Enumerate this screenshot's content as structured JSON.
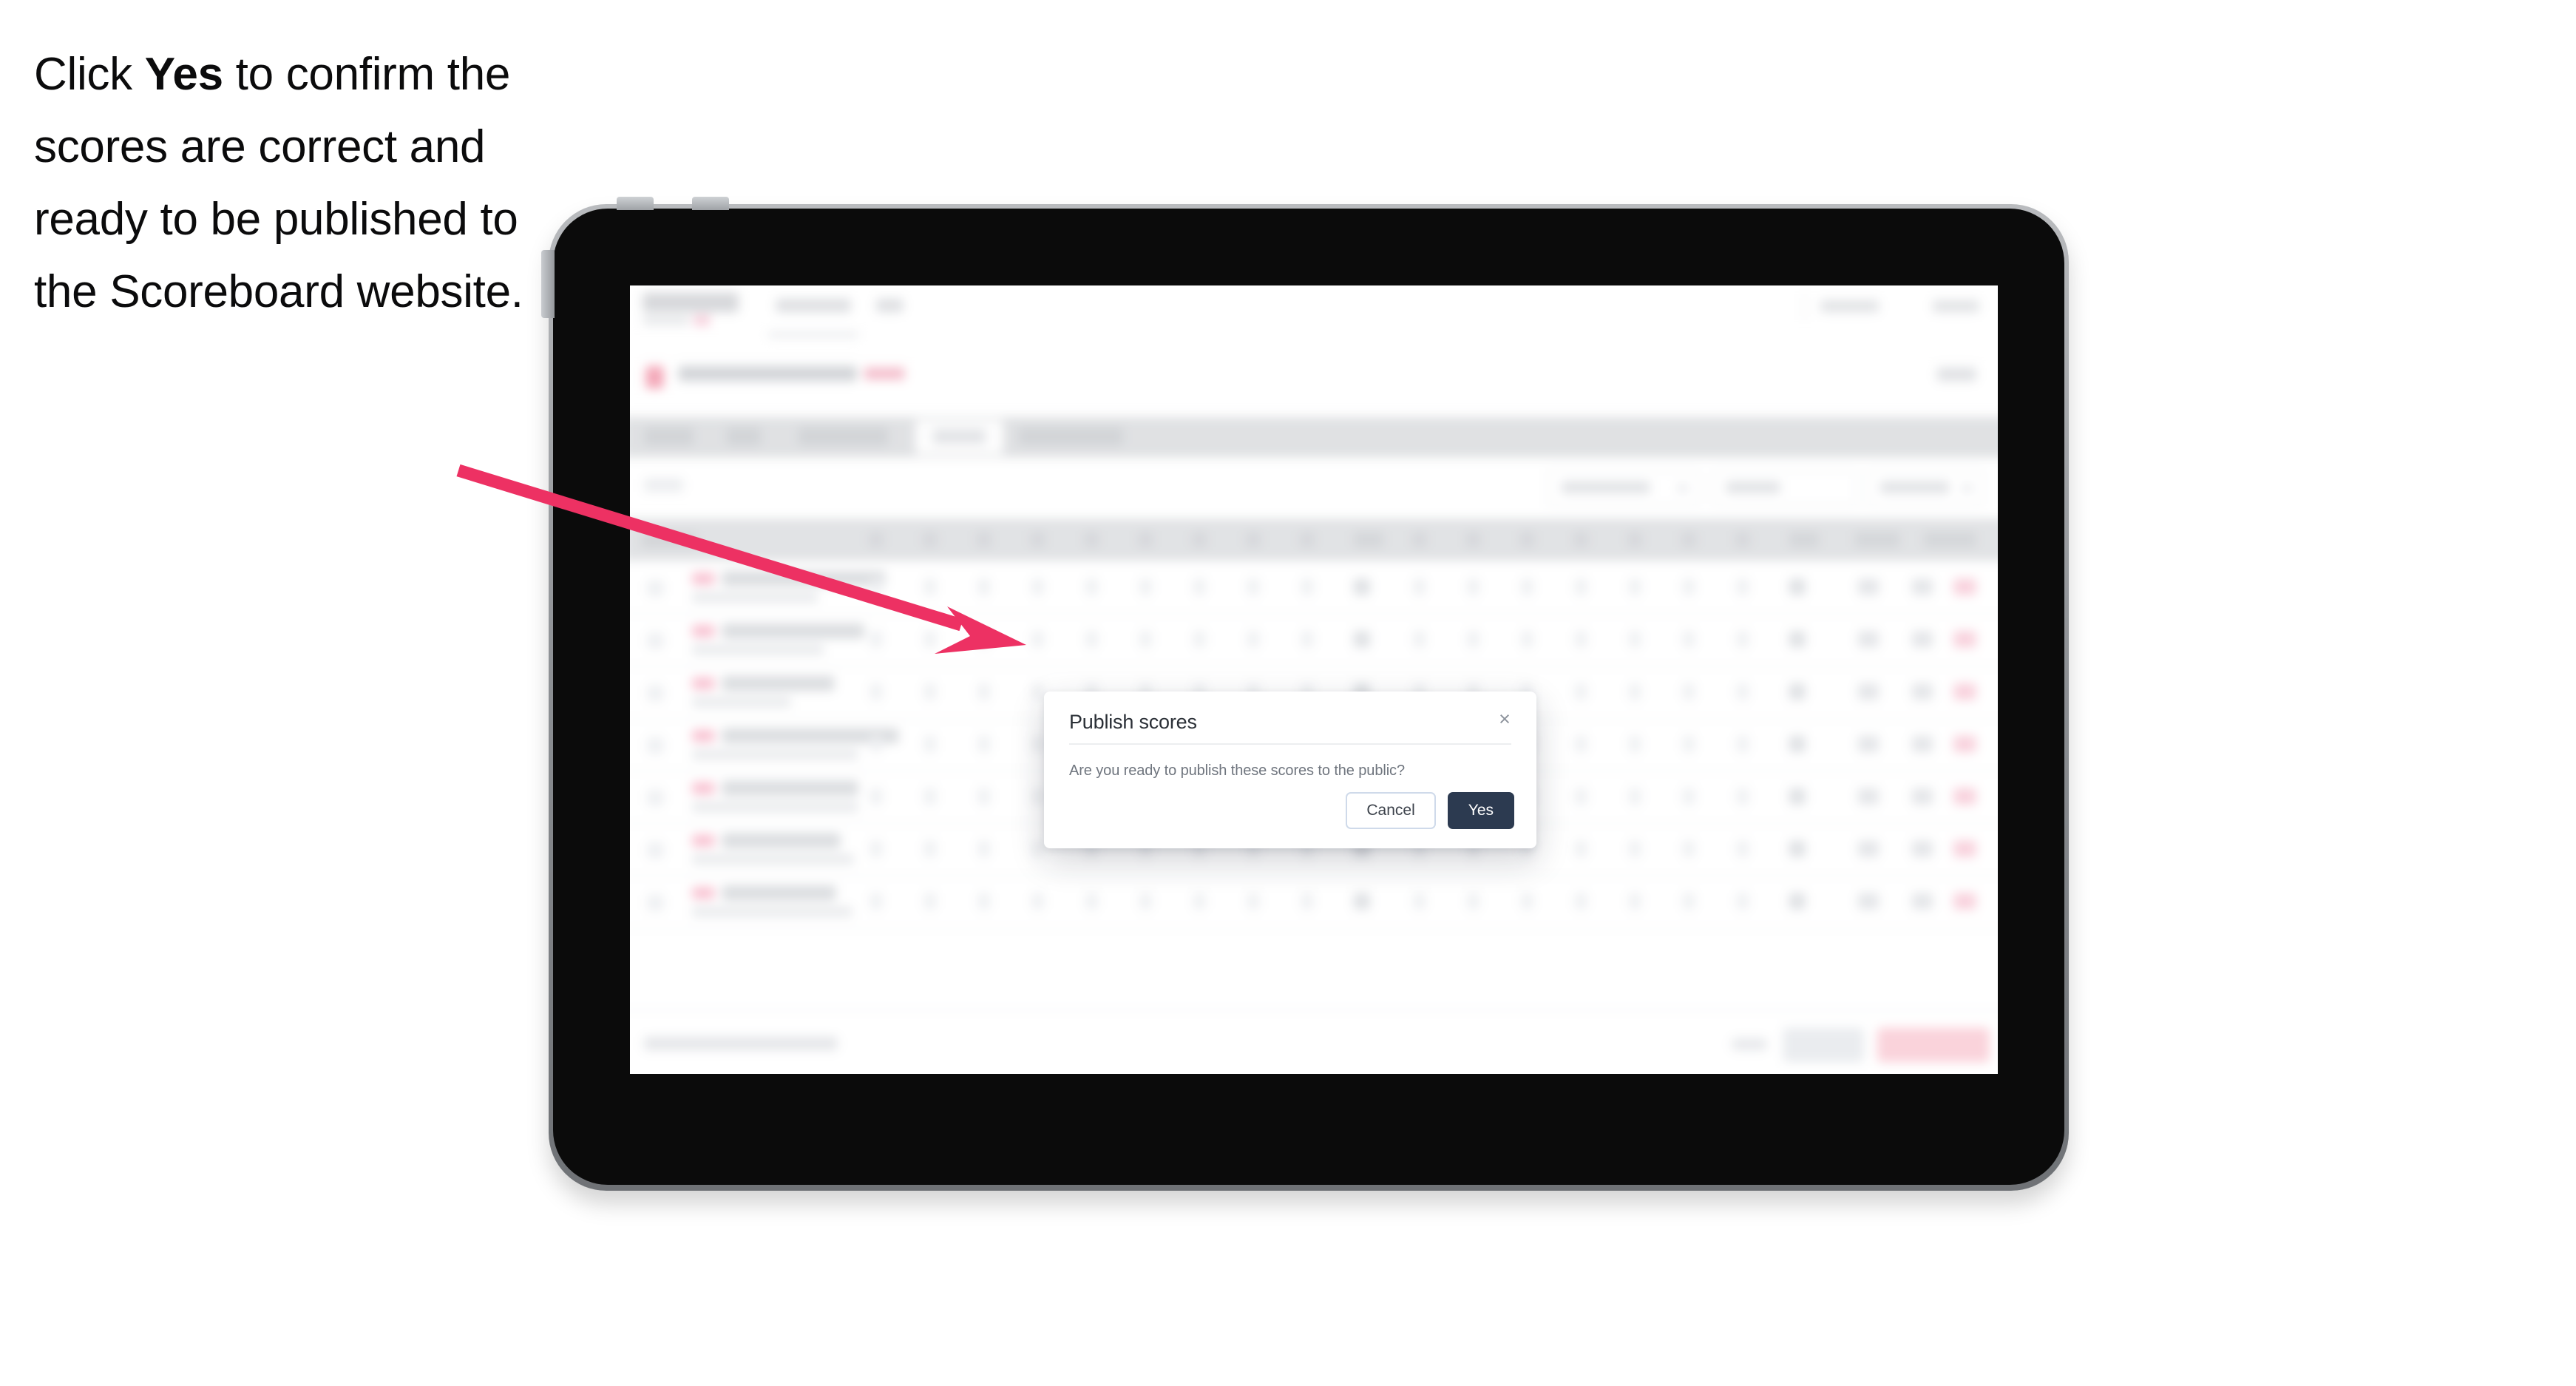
{
  "annotation": {
    "text_before": "Click ",
    "text_bold": "Yes",
    "text_after": " to confirm the scores are correct and ready to be published to the Scoreboard website.",
    "arrow_color": "#ED3163",
    "arrow_name": "pointer-arrow"
  },
  "device": {
    "type": "tablet",
    "frame_color": "#0b0b0b",
    "edge_color": "#8d9094"
  },
  "dialog": {
    "title": "Publish scores",
    "body": "Are you ready to publish these scores to the public?",
    "close_icon": "×",
    "cancel_label": "Cancel",
    "yes_label": "Yes",
    "yes_color": "#2c3a50",
    "cancel_border_color": "#cfdaea"
  },
  "background_app": {
    "blurred": true,
    "tabs_count": 5,
    "active_tab_index": 4,
    "filter_controls_count": 3,
    "table_rows_count": 7,
    "primary_action_color": "#f9c4cf",
    "accent_color": "#f0889f"
  }
}
